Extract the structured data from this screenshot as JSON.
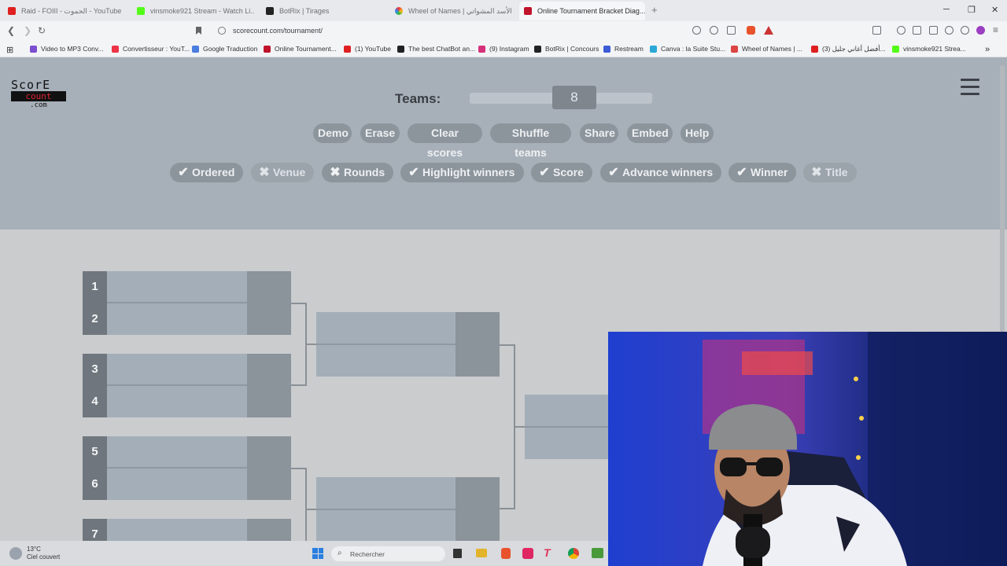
{
  "browser": {
    "tabs": [
      {
        "title": "Raid - FOIII - الحموت - YouTube",
        "color": "#e02020"
      },
      {
        "title": "vinsmoke921 Stream - Watch Li...",
        "color": "#2a2a2a"
      },
      {
        "title": "BotRix | Tirages",
        "color": "#222"
      },
      {
        "title": "Wheel of Names | أحلى الأسد المشواتي...",
        "color": "#d44"
      },
      {
        "title": "Online Tournament Bracket Diag...",
        "color": "#c0142b"
      }
    ],
    "url": "scorecount.com/tournament/",
    "bookmarks": [
      {
        "label": "Video to MP3 Conv...",
        "color": "#7b4fd0"
      },
      {
        "label": "Convertisseur : YouT...",
        "color": "#e34"
      },
      {
        "label": "Google Traduction",
        "color": "#4a7ee0"
      },
      {
        "label": "Online Tournament...",
        "color": "#c0142b"
      },
      {
        "label": "(1) YouTube",
        "color": "#e02020"
      },
      {
        "label": "The best ChatBot an...",
        "color": "#222"
      },
      {
        "label": "(9) Instagram",
        "color": "#d6307a"
      },
      {
        "label": "BotRix | Concours",
        "color": "#222"
      },
      {
        "label": "Restream",
        "color": "#3b5cd6"
      },
      {
        "label": "Canva : la Suite Stu...",
        "color": "#2aa8d8"
      },
      {
        "label": "Wheel of Names | ...",
        "color": "#d44"
      },
      {
        "label": "(3) أفضل أغاني جليل...",
        "color": "#e02020"
      },
      {
        "label": "vinsmoke921 Strea...",
        "color": "#2a2a2a"
      }
    ]
  },
  "app": {
    "logo": {
      "line1": "ScorE",
      "line2": "count",
      "line3": ".com"
    },
    "teams_label": "Teams:",
    "teams_value": "8",
    "actions": [
      "Demo",
      "Erase",
      "Clear scores",
      "Shuffle teams",
      "Share",
      "Embed",
      "Help"
    ],
    "options": [
      {
        "label": "Ordered",
        "on": true
      },
      {
        "label": "Venue",
        "on": false
      },
      {
        "label": "Rounds",
        "on": false
      },
      {
        "label": "Highlight winners",
        "on": true
      },
      {
        "label": "Score",
        "on": true
      },
      {
        "label": "Advance winners",
        "on": true
      },
      {
        "label": "Winner",
        "on": true
      },
      {
        "label": "Title",
        "on": false
      }
    ],
    "seeds": [
      "1",
      "2",
      "3",
      "4",
      "5",
      "6",
      "7"
    ]
  },
  "taskbar": {
    "weather_temp": "13°C",
    "weather_desc": "Ciel couvert",
    "search_placeholder": "Rechercher"
  }
}
